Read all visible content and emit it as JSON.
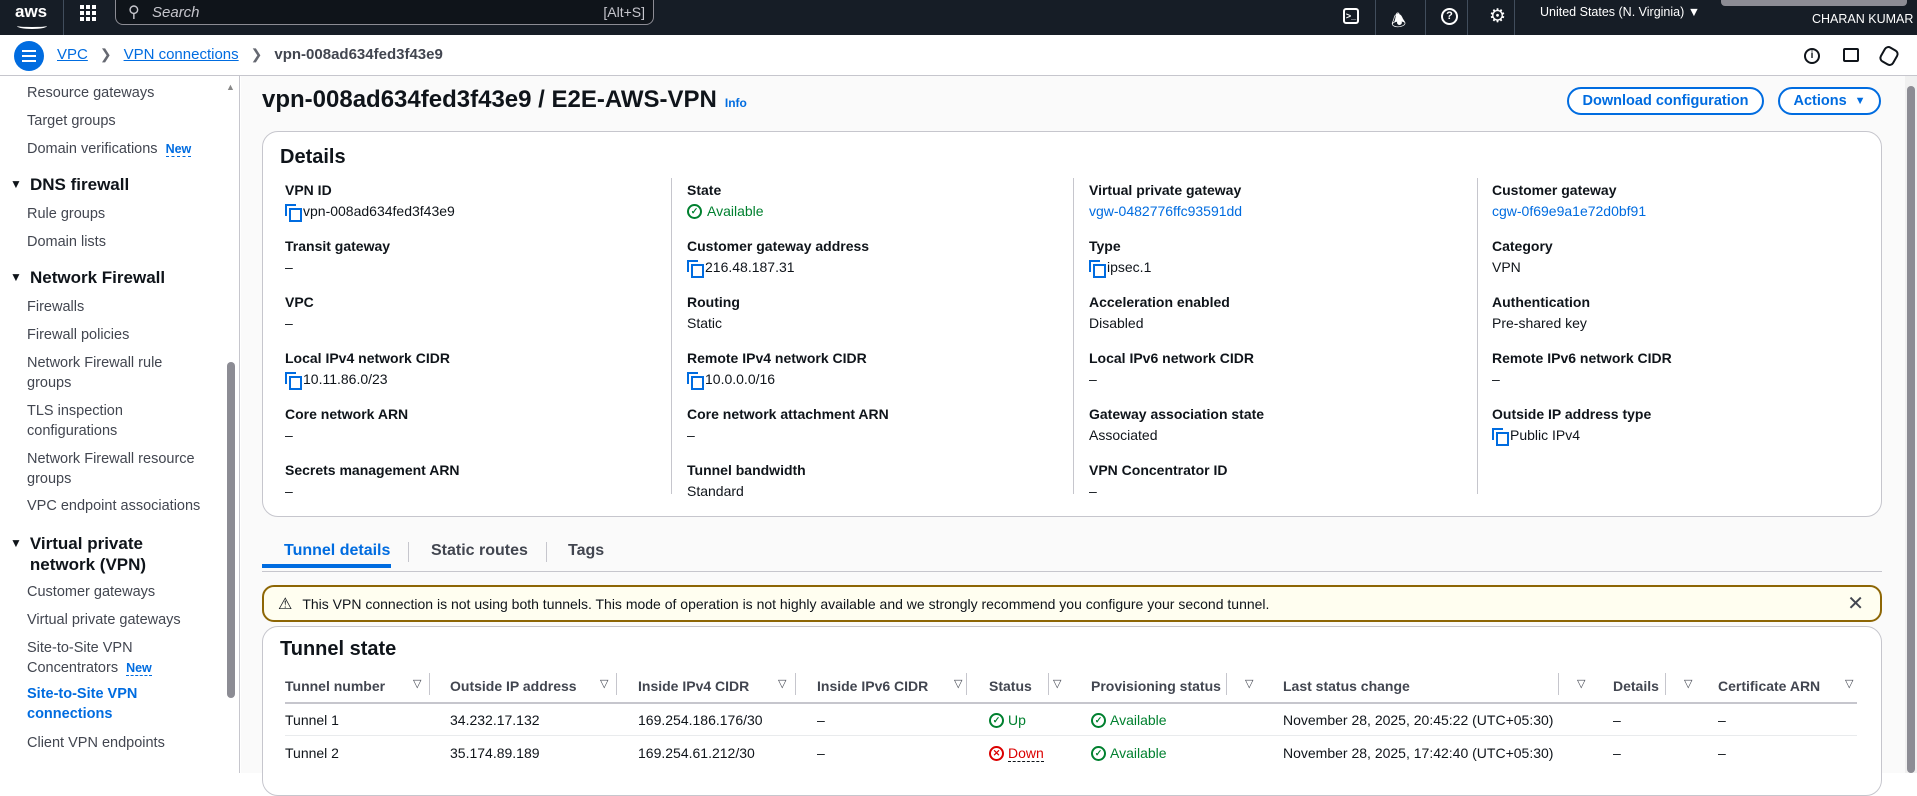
{
  "topnav": {
    "logo": "aws",
    "search_placeholder": "Search",
    "search_shortcut": "[Alt+S]",
    "region": "United States (N. Virginia)",
    "user": "CHARAN KUMAR",
    "icons": [
      "cloudshell-icon",
      "bell-icon",
      "help-icon",
      "gear-icon"
    ]
  },
  "breadcrumb": {
    "items": [
      "VPC",
      "VPN connections"
    ],
    "current": "vpn-008ad634fed3f43e9"
  },
  "sidebar": {
    "items_a": [
      "Resource gateways",
      "Target groups",
      "Domain verifications"
    ],
    "new_badge": "New",
    "dns_header": "DNS firewall",
    "dns_items": [
      "Rule groups",
      "Domain lists"
    ],
    "nf_header": "Network Firewall",
    "nf_items": [
      "Firewalls",
      "Firewall policies",
      "Network Firewall rule groups",
      "TLS inspection configurations",
      "Network Firewall resource groups",
      "VPC endpoint associations"
    ],
    "vpn_header": "Virtual private network (VPN)",
    "vpn_items": [
      "Customer gateways",
      "Virtual private gateways",
      "Site-to-Site VPN Concentrators",
      "Site-to-Site VPN connections",
      "Client VPN endpoints"
    ]
  },
  "page": {
    "title": "vpn-008ad634fed3f43e9 / E2E-AWS-VPN",
    "info": "Info",
    "download_button": "Download configuration",
    "actions_button": "Actions"
  },
  "details": {
    "title": "Details",
    "columns": [
      [
        {
          "label": "VPN ID",
          "value": "vpn-008ad634fed3f43e9",
          "copy": true
        },
        {
          "label": "Transit gateway",
          "value": "–"
        },
        {
          "label": "VPC",
          "value": "–"
        },
        {
          "label": "Local IPv4 network CIDR",
          "value": "10.11.86.0/23",
          "copy": true
        },
        {
          "label": "Core network ARN",
          "value": "–"
        },
        {
          "label": "Secrets management ARN",
          "value": "–"
        }
      ],
      [
        {
          "label": "State",
          "value": "Available",
          "status": "ok"
        },
        {
          "label": "Customer gateway address",
          "value": "216.48.187.31",
          "copy": true
        },
        {
          "label": "Routing",
          "value": "Static"
        },
        {
          "label": "Remote IPv4 network CIDR",
          "value": "10.0.0.0/16",
          "copy": true
        },
        {
          "label": "Core network attachment ARN",
          "value": "–"
        },
        {
          "label": "Tunnel bandwidth",
          "value": "Standard"
        }
      ],
      [
        {
          "label": "Virtual private gateway",
          "value": "vgw-0482776ffc93591dd",
          "link": true
        },
        {
          "label": "Type",
          "value": "ipsec.1",
          "copy": true
        },
        {
          "label": "Acceleration enabled",
          "value": "Disabled"
        },
        {
          "label": "Local IPv6 network CIDR",
          "value": "–"
        },
        {
          "label": "Gateway association state",
          "value": "Associated"
        },
        {
          "label": "VPN Concentrator ID",
          "value": "–"
        }
      ],
      [
        {
          "label": "Customer gateway",
          "value": "cgw-0f69e9a1e72d0bf91",
          "link": true
        },
        {
          "label": "Category",
          "value": "VPN"
        },
        {
          "label": "Authentication",
          "value": "Pre-shared key"
        },
        {
          "label": "Remote IPv6 network CIDR",
          "value": "–"
        },
        {
          "label": "Outside IP address type",
          "value": "Public IPv4",
          "copy": true
        }
      ]
    ]
  },
  "tabs": [
    "Tunnel details",
    "Static routes",
    "Tags"
  ],
  "alert": {
    "text": "This VPN connection is not using both tunnels. This mode of operation is not highly available and we strongly recommend you configure your second tunnel."
  },
  "tunnel_state": {
    "title": "Tunnel state",
    "headers": [
      "Tunnel number",
      "Outside IP address",
      "Inside IPv4 CIDR",
      "Inside IPv6 CIDR",
      "Status",
      "Provisioning status",
      "Last status change",
      "Details",
      "Certificate ARN"
    ],
    "rows": [
      [
        "Tunnel 1",
        "34.232.17.132",
        "169.254.186.176/30",
        "–",
        "Up",
        "Available",
        "November 28, 2025, 20:45:22 (UTC+05:30)",
        "–",
        "–"
      ],
      [
        "Tunnel 2",
        "35.174.89.189",
        "169.254.61.212/30",
        "–",
        "Down",
        "Available",
        "November 28, 2025, 17:42:40 (UTC+05:30)",
        "–",
        "–"
      ]
    ]
  },
  "colors": {
    "accent": "#006ce0",
    "nav": "#161d26",
    "success": "#00802f",
    "error": "#db0000",
    "warning": "#8d6605"
  }
}
